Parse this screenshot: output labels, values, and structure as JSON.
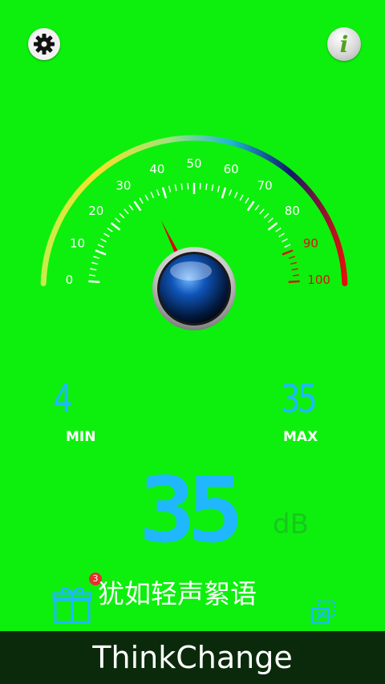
{
  "top_bar": {
    "settings_icon": "gear-icon",
    "info_icon": "info-icon",
    "info_label": "i"
  },
  "gauge": {
    "tick_labels": [
      "0",
      "10",
      "20",
      "30",
      "40",
      "50",
      "60",
      "70",
      "80",
      "90",
      "100"
    ],
    "needle_value": 35,
    "range": [
      0,
      100
    ],
    "label_color_normal": "#ffffff",
    "label_color_high": "#e01010"
  },
  "readings": {
    "min_value": "4",
    "min_label": "MIN",
    "max_value": "35",
    "max_label": "MAX",
    "current_value": "35",
    "unit": "dB"
  },
  "description": {
    "badge_count": "3",
    "text": "犹如轻声絮语",
    "gift_icon": "gift-icon",
    "resize_icon": "resize-icon"
  },
  "footer": {
    "brand": "ThinkChange"
  },
  "colors": {
    "background": "#0df00d",
    "digits": "#1fb8ff",
    "footer": "#0b2a0b"
  }
}
